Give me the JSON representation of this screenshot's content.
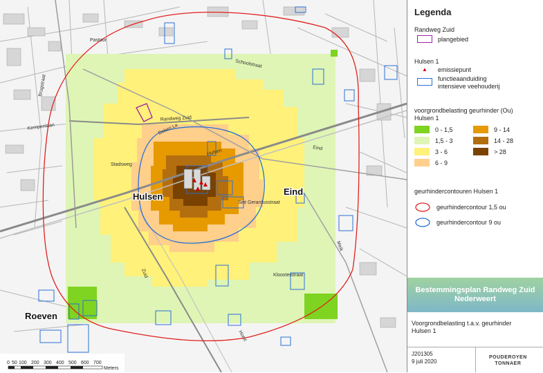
{
  "map": {
    "place_labels": {
      "hulsen": "Hulsen",
      "eind": "Eind",
      "roeven": "Roeven"
    },
    "street_labels": {
      "randweg_zuid": "Randweg Zuid",
      "schoolstraat": "Schoolstraat",
      "sint_gerardusstraat": "Sint Gerardusstraat",
      "kloosterstraat": "Kloosterstraat",
      "roeven": "Roeven",
      "deken_la": "Deken La",
      "hulsen_st": "Hulsen",
      "eind_st": "Eind",
      "kempenlaan": "Kempenlaan",
      "horst": "Horst",
      "meik": "Meik",
      "stadsweg": "Stadsweg",
      "brug": "Brugstraat",
      "zuid": "Zuid",
      "pastoor": "Pastoor"
    },
    "scale": {
      "ticks": [
        "0",
        "50",
        "100",
        "200",
        "300",
        "400",
        "500",
        "600",
        "700"
      ],
      "unit": "Meters"
    }
  },
  "legend": {
    "title": "Legenda",
    "randweg_heading": "Randweg Zuid",
    "plangebied": "plangebied",
    "hulsen_heading": "Hulsen 1",
    "emissiepunt": "emissiepunt",
    "functie_line1": "functieaanduiding",
    "functie_line2": "intensieve veehouderij",
    "voorgrond_line1": "voorgrondbelasting geurhinder (Ou)",
    "voorgrond_line2": "Hulsen 1",
    "classes": [
      {
        "label": "0 - 1,5",
        "color": "#7fd321"
      },
      {
        "label": "1,5 - 3",
        "color": "#dff5b5"
      },
      {
        "label": "3 - 6",
        "color": "#fff17a"
      },
      {
        "label": "6 - 9",
        "color": "#ffcf8c"
      },
      {
        "label": "9 - 14",
        "color": "#e69a00"
      },
      {
        "label": "14 - 28",
        "color": "#b36e10"
      },
      {
        "label": "> 28",
        "color": "#7a4200"
      }
    ],
    "contour_heading": "geurhindercontouren Hulsen 1",
    "contour_15": "geurhindercontour 1,5 ou",
    "contour_9": "geurhindercontour 9 ou",
    "contour_15_color": "#e0201c",
    "contour_9_color": "#2a6fd6"
  },
  "titleblock": {
    "plan_line1": "Bestemmingsplan Randweg Zuid",
    "plan_line2": "Nederweert",
    "desc_line1": "Voorgrondbelasting t.a.v. geurhinder",
    "desc_line2": "Hulsen 1",
    "job_number": "J201305",
    "date": "9 juli 2020",
    "brand_line1": "POUDEROYEN",
    "brand_line2": "TONNAER"
  }
}
